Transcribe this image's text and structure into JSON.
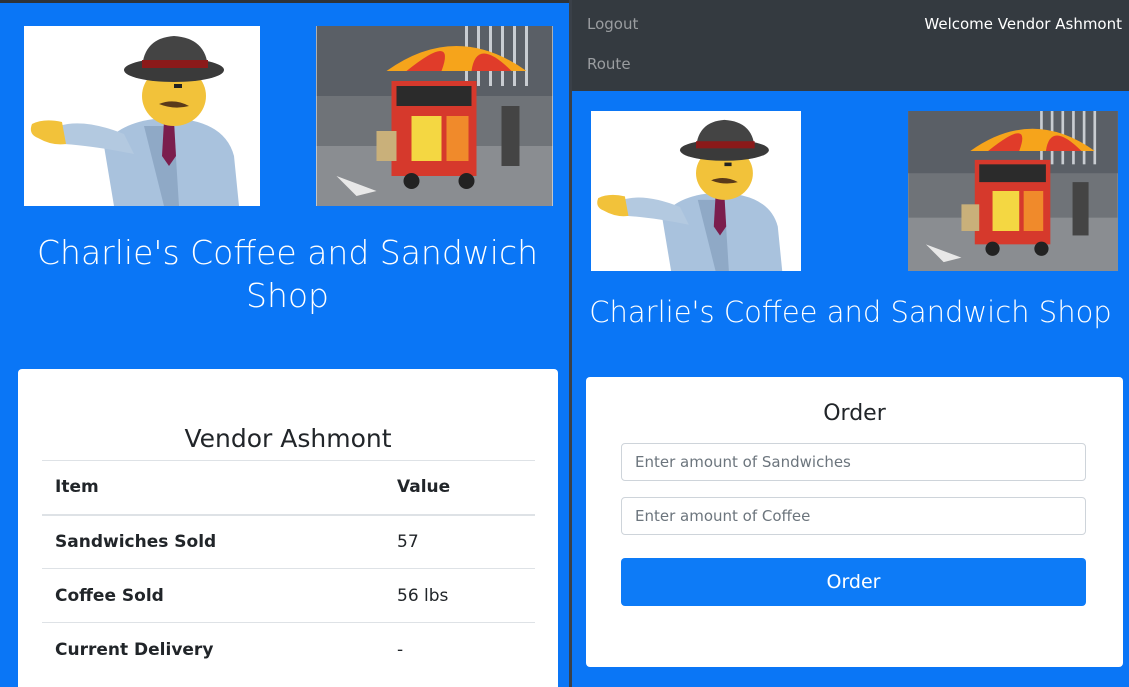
{
  "shop": {
    "title": "Charlie's Coffee and Sandwich Shop"
  },
  "left": {
    "vendor_title": "Vendor Ashmont",
    "table": {
      "headers": [
        "Item",
        "Value"
      ],
      "rows": [
        {
          "label": "Sandwiches Sold",
          "value": "57"
        },
        {
          "label": "Coffee Sold",
          "value": "56 lbs"
        },
        {
          "label": "Current Delivery",
          "value": "-"
        }
      ]
    }
  },
  "navbar": {
    "links": [
      "Logout",
      "Route"
    ],
    "welcome": "Welcome Vendor Ashmont"
  },
  "order": {
    "title": "Order",
    "sandwich_placeholder": "Enter amount of Sandwiches",
    "coffee_placeholder": "Enter amount of Coffee",
    "button_label": "Order"
  },
  "images": {
    "mascot": "mascot-image",
    "cart": "food-cart-image"
  },
  "colors": {
    "background": "#0a76f6",
    "navbar": "#343a40",
    "button": "#0d7bf7"
  }
}
